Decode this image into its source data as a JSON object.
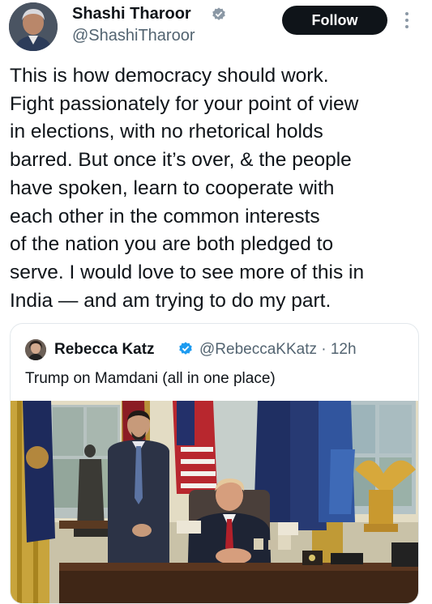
{
  "author": {
    "name": "Shashi Tharoor",
    "handle": "@ShashiTharoor",
    "verified_icon": "verified-badge-icon",
    "avatar_icon": "profile-photo"
  },
  "follow_button": {
    "label": "Follow"
  },
  "more_icon": "more-options-icon",
  "tweet": {
    "lines": [
      "This is how democracy should work.",
      "Fight passionately for your point of view",
      "in elections, with no rhetorical holds",
      "barred. But once it’s over, & the people",
      "have spoken, learn to cooperate with",
      "each other in the common interests",
      "of the nation you are both pledged to",
      "serve. I would love to see more of this in",
      "India — and am trying to do my part."
    ]
  },
  "quoted_tweet": {
    "name": "Rebecca Katz",
    "handle_time": "@RebeccaKKatz · 12h",
    "text": "Trump on Mamdani (all in one place)",
    "media": "photo-oval-office"
  },
  "colors": {
    "text": "#0f1419",
    "secondary": "#536471",
    "verified": "#1d9bf0",
    "follow_bg": "#0f1419",
    "border": "#e3e8ec"
  }
}
